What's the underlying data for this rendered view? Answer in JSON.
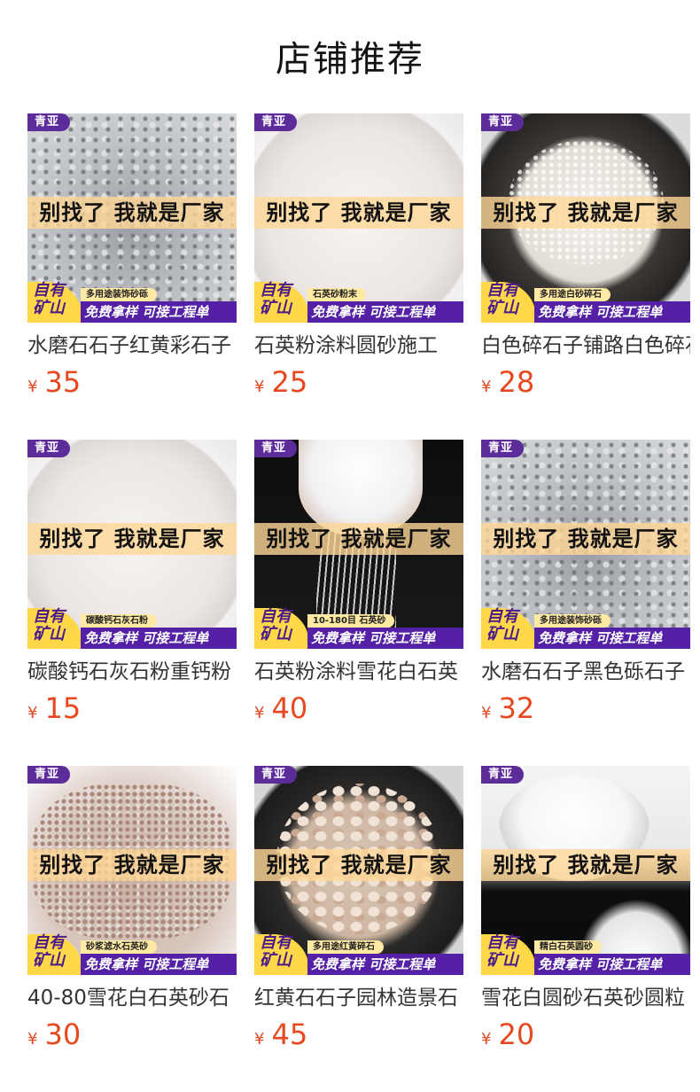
{
  "page_title": "店铺推荐",
  "common": {
    "brand": "青亚",
    "banner": "别找了 我就是厂家",
    "zy_line1": "自有",
    "zy_line2": "矿山",
    "strip": "免费拿样 可接工程单",
    "currency": "¥"
  },
  "products": [
    {
      "name": "水磨石石子红黄彩石子",
      "price": "35",
      "tag": "多用途装饰砂砾"
    },
    {
      "name": "石英粉涂料圆砂施工",
      "price": "25",
      "tag": "石英砂粉末"
    },
    {
      "name": "白色碎石子铺路白色碎石",
      "price": "28",
      "tag": "多用途白砂碎石"
    },
    {
      "name": "碳酸钙石灰石粉重钙粉",
      "price": "15",
      "tag": "碳酸钙石灰石粉"
    },
    {
      "name": "石英粉涂料雪花白石英",
      "price": "40",
      "tag": "10-180目 石英砂"
    },
    {
      "name": "水磨石石子黑色砾石子",
      "price": "32",
      "tag": "多用途装饰砂砾"
    },
    {
      "name": "40-80雪花白石英砂石",
      "price": "30",
      "tag": "砂浆滤水石英砂"
    },
    {
      "name": "红黄石石子园林造景石",
      "price": "45",
      "tag": "多用途红黄碎石"
    },
    {
      "name": "雪花白圆砂石英砂圆粒",
      "price": "20",
      "tag": "精白石英圆砂"
    }
  ]
}
